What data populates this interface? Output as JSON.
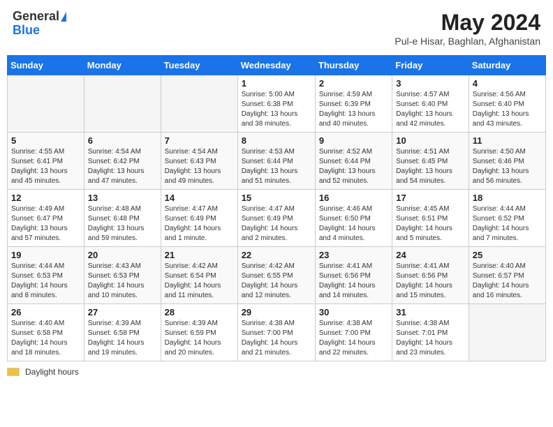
{
  "header": {
    "logo_general": "General",
    "logo_blue": "Blue",
    "month_title": "May 2024",
    "location": "Pul-e Hisar, Baghlan, Afghanistan"
  },
  "days_of_week": [
    "Sunday",
    "Monday",
    "Tuesday",
    "Wednesday",
    "Thursday",
    "Friday",
    "Saturday"
  ],
  "weeks": [
    [
      {
        "day": "",
        "info": ""
      },
      {
        "day": "",
        "info": ""
      },
      {
        "day": "",
        "info": ""
      },
      {
        "day": "1",
        "info": "Sunrise: 5:00 AM\nSunset: 6:38 PM\nDaylight: 13 hours\nand 38 minutes."
      },
      {
        "day": "2",
        "info": "Sunrise: 4:59 AM\nSunset: 6:39 PM\nDaylight: 13 hours\nand 40 minutes."
      },
      {
        "day": "3",
        "info": "Sunrise: 4:57 AM\nSunset: 6:40 PM\nDaylight: 13 hours\nand 42 minutes."
      },
      {
        "day": "4",
        "info": "Sunrise: 4:56 AM\nSunset: 6:40 PM\nDaylight: 13 hours\nand 43 minutes."
      }
    ],
    [
      {
        "day": "5",
        "info": "Sunrise: 4:55 AM\nSunset: 6:41 PM\nDaylight: 13 hours\nand 45 minutes."
      },
      {
        "day": "6",
        "info": "Sunrise: 4:54 AM\nSunset: 6:42 PM\nDaylight: 13 hours\nand 47 minutes."
      },
      {
        "day": "7",
        "info": "Sunrise: 4:54 AM\nSunset: 6:43 PM\nDaylight: 13 hours\nand 49 minutes."
      },
      {
        "day": "8",
        "info": "Sunrise: 4:53 AM\nSunset: 6:44 PM\nDaylight: 13 hours\nand 51 minutes."
      },
      {
        "day": "9",
        "info": "Sunrise: 4:52 AM\nSunset: 6:44 PM\nDaylight: 13 hours\nand 52 minutes."
      },
      {
        "day": "10",
        "info": "Sunrise: 4:51 AM\nSunset: 6:45 PM\nDaylight: 13 hours\nand 54 minutes."
      },
      {
        "day": "11",
        "info": "Sunrise: 4:50 AM\nSunset: 6:46 PM\nDaylight: 13 hours\nand 56 minutes."
      }
    ],
    [
      {
        "day": "12",
        "info": "Sunrise: 4:49 AM\nSunset: 6:47 PM\nDaylight: 13 hours\nand 57 minutes."
      },
      {
        "day": "13",
        "info": "Sunrise: 4:48 AM\nSunset: 6:48 PM\nDaylight: 13 hours\nand 59 minutes."
      },
      {
        "day": "14",
        "info": "Sunrise: 4:47 AM\nSunset: 6:49 PM\nDaylight: 14 hours\nand 1 minute."
      },
      {
        "day": "15",
        "info": "Sunrise: 4:47 AM\nSunset: 6:49 PM\nDaylight: 14 hours\nand 2 minutes."
      },
      {
        "day": "16",
        "info": "Sunrise: 4:46 AM\nSunset: 6:50 PM\nDaylight: 14 hours\nand 4 minutes."
      },
      {
        "day": "17",
        "info": "Sunrise: 4:45 AM\nSunset: 6:51 PM\nDaylight: 14 hours\nand 5 minutes."
      },
      {
        "day": "18",
        "info": "Sunrise: 4:44 AM\nSunset: 6:52 PM\nDaylight: 14 hours\nand 7 minutes."
      }
    ],
    [
      {
        "day": "19",
        "info": "Sunrise: 4:44 AM\nSunset: 6:53 PM\nDaylight: 14 hours\nand 8 minutes."
      },
      {
        "day": "20",
        "info": "Sunrise: 4:43 AM\nSunset: 6:53 PM\nDaylight: 14 hours\nand 10 minutes."
      },
      {
        "day": "21",
        "info": "Sunrise: 4:42 AM\nSunset: 6:54 PM\nDaylight: 14 hours\nand 11 minutes."
      },
      {
        "day": "22",
        "info": "Sunrise: 4:42 AM\nSunset: 6:55 PM\nDaylight: 14 hours\nand 12 minutes."
      },
      {
        "day": "23",
        "info": "Sunrise: 4:41 AM\nSunset: 6:56 PM\nDaylight: 14 hours\nand 14 minutes."
      },
      {
        "day": "24",
        "info": "Sunrise: 4:41 AM\nSunset: 6:56 PM\nDaylight: 14 hours\nand 15 minutes."
      },
      {
        "day": "25",
        "info": "Sunrise: 4:40 AM\nSunset: 6:57 PM\nDaylight: 14 hours\nand 16 minutes."
      }
    ],
    [
      {
        "day": "26",
        "info": "Sunrise: 4:40 AM\nSunset: 6:58 PM\nDaylight: 14 hours\nand 18 minutes."
      },
      {
        "day": "27",
        "info": "Sunrise: 4:39 AM\nSunset: 6:58 PM\nDaylight: 14 hours\nand 19 minutes."
      },
      {
        "day": "28",
        "info": "Sunrise: 4:39 AM\nSunset: 6:59 PM\nDaylight: 14 hours\nand 20 minutes."
      },
      {
        "day": "29",
        "info": "Sunrise: 4:38 AM\nSunset: 7:00 PM\nDaylight: 14 hours\nand 21 minutes."
      },
      {
        "day": "30",
        "info": "Sunrise: 4:38 AM\nSunset: 7:00 PM\nDaylight: 14 hours\nand 22 minutes."
      },
      {
        "day": "31",
        "info": "Sunrise: 4:38 AM\nSunset: 7:01 PM\nDaylight: 14 hours\nand 23 minutes."
      },
      {
        "day": "",
        "info": ""
      }
    ]
  ],
  "footer": {
    "daylight_label": "Daylight hours"
  }
}
